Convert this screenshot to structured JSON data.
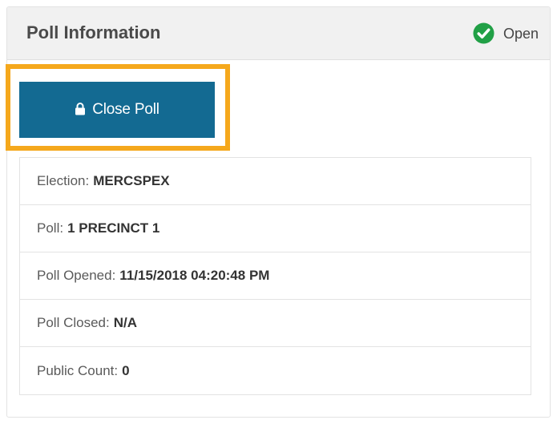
{
  "panel": {
    "title": "Poll Information",
    "status": {
      "label": "Open",
      "icon": "check-circle-icon",
      "color": "#21a046"
    }
  },
  "actions": {
    "close_poll_label": "Close Poll",
    "close_poll_icon": "lock-icon",
    "button_color": "#136a92",
    "highlight_color": "#f5a81c"
  },
  "info": [
    {
      "label": "Election:",
      "value": "MERCSPEX"
    },
    {
      "label": "Poll:",
      "value": "1 PRECINCT 1"
    },
    {
      "label": "Poll Opened:",
      "value": "11/15/2018 04:20:48 PM"
    },
    {
      "label": "Poll Closed:",
      "value": "N/A"
    },
    {
      "label": "Public Count:",
      "value": "0"
    }
  ]
}
